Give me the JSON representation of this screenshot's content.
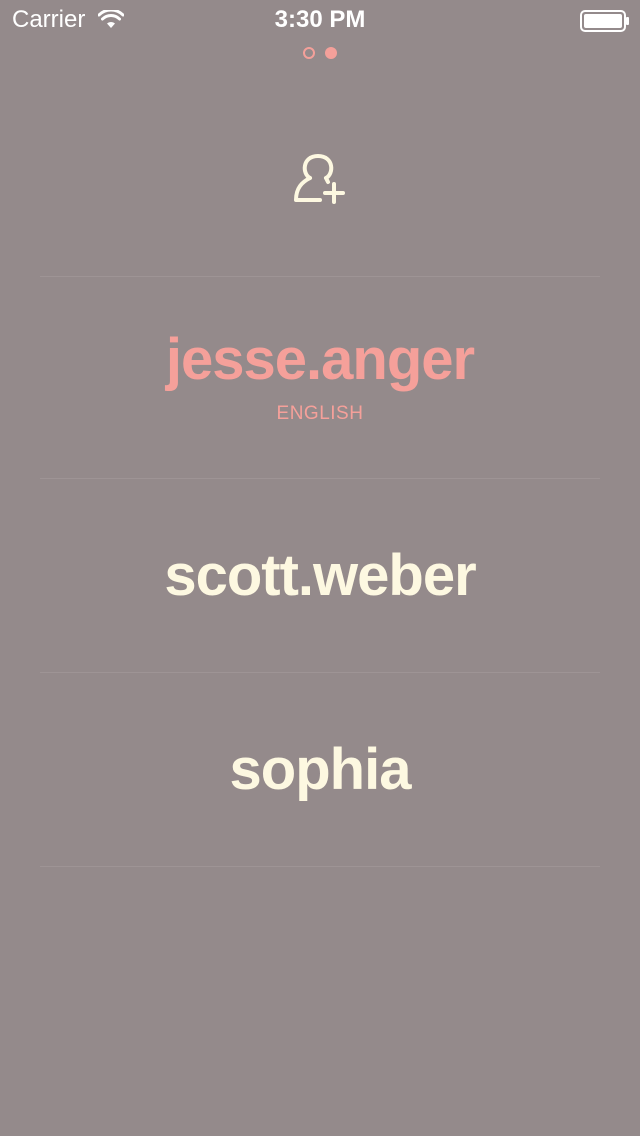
{
  "status_bar": {
    "carrier": "Carrier",
    "time": "3:30 PM",
    "wifi_icon": "wifi-icon",
    "battery_icon": "battery-icon"
  },
  "pager": {
    "pages": 2,
    "current": 2
  },
  "add_user": {
    "icon": "add-user-icon"
  },
  "accounts": [
    {
      "name": "jesse.anger",
      "language": "ENGLISH",
      "active": true
    },
    {
      "name": "scott.weber",
      "language": "",
      "active": false
    },
    {
      "name": "sophia",
      "language": "",
      "active": false
    }
  ],
  "colors": {
    "background": "#948a8b",
    "accent": "#f5a09a",
    "text": "#fdf8e1",
    "divider": "#9e9495"
  }
}
